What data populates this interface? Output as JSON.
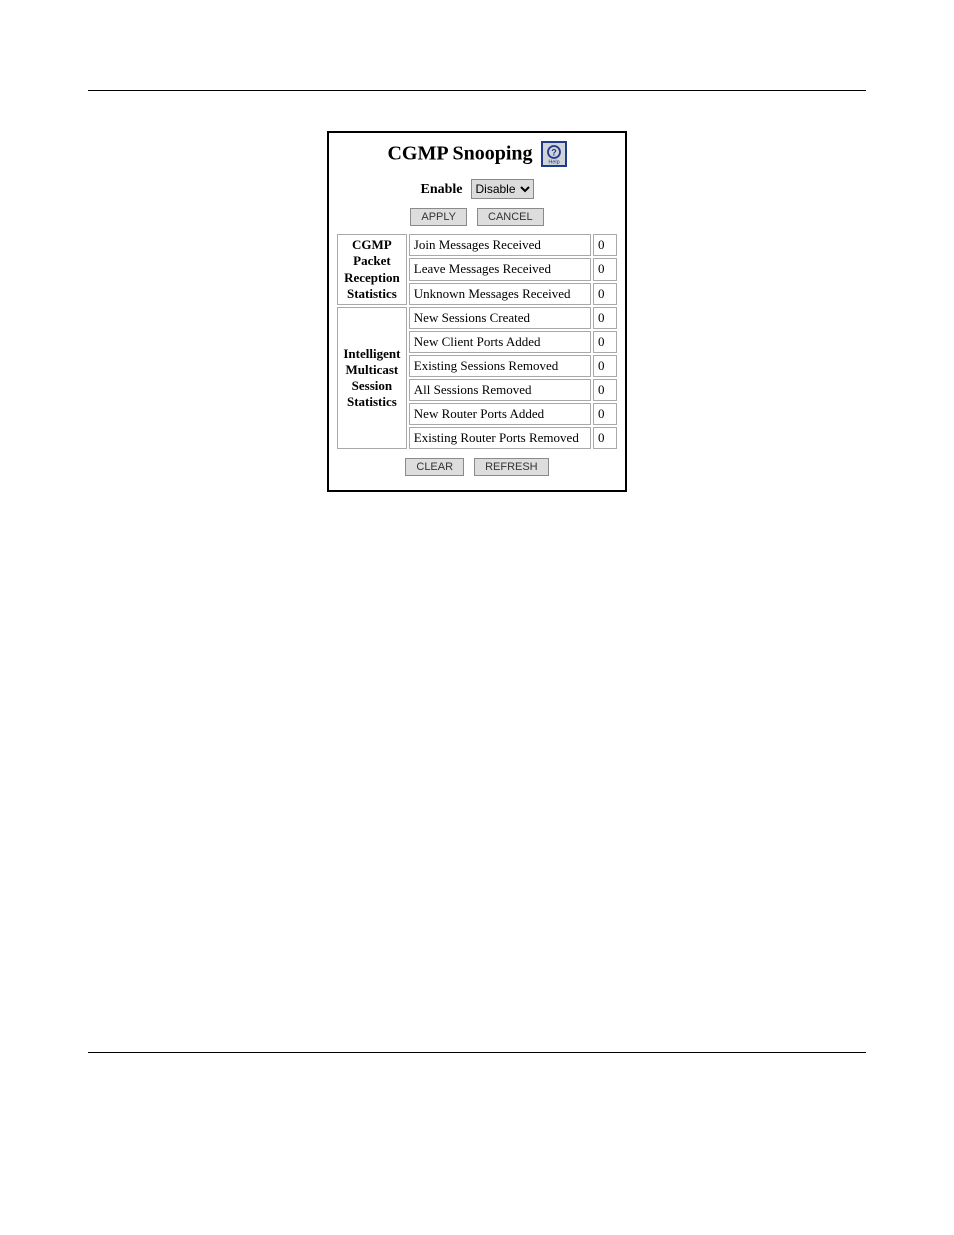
{
  "panel": {
    "title": "CGMP Snooping",
    "help_icon": "help-icon",
    "enable_label": "Enable",
    "enable_selected": "Disable",
    "apply_label": "APPLY",
    "cancel_label": "CANCEL",
    "clear_label": "CLEAR",
    "refresh_label": "REFRESH",
    "section1": {
      "header": "CGMP Packet Reception Statistics",
      "rows": [
        {
          "label": "Join Messages Received",
          "value": "0"
        },
        {
          "label": "Leave Messages Received",
          "value": "0"
        },
        {
          "label": "Unknown Messages Received",
          "value": "0"
        }
      ]
    },
    "section2": {
      "header": "Intelligent Multicast Session Statistics",
      "rows": [
        {
          "label": "New Sessions Created",
          "value": "0"
        },
        {
          "label": "New Client Ports Added",
          "value": "0"
        },
        {
          "label": "Existing Sessions Removed",
          "value": "0"
        },
        {
          "label": "All Sessions Removed",
          "value": "0"
        },
        {
          "label": "New Router Ports Added",
          "value": "0"
        },
        {
          "label": "Existing Router Ports Removed",
          "value": "0"
        }
      ]
    }
  }
}
